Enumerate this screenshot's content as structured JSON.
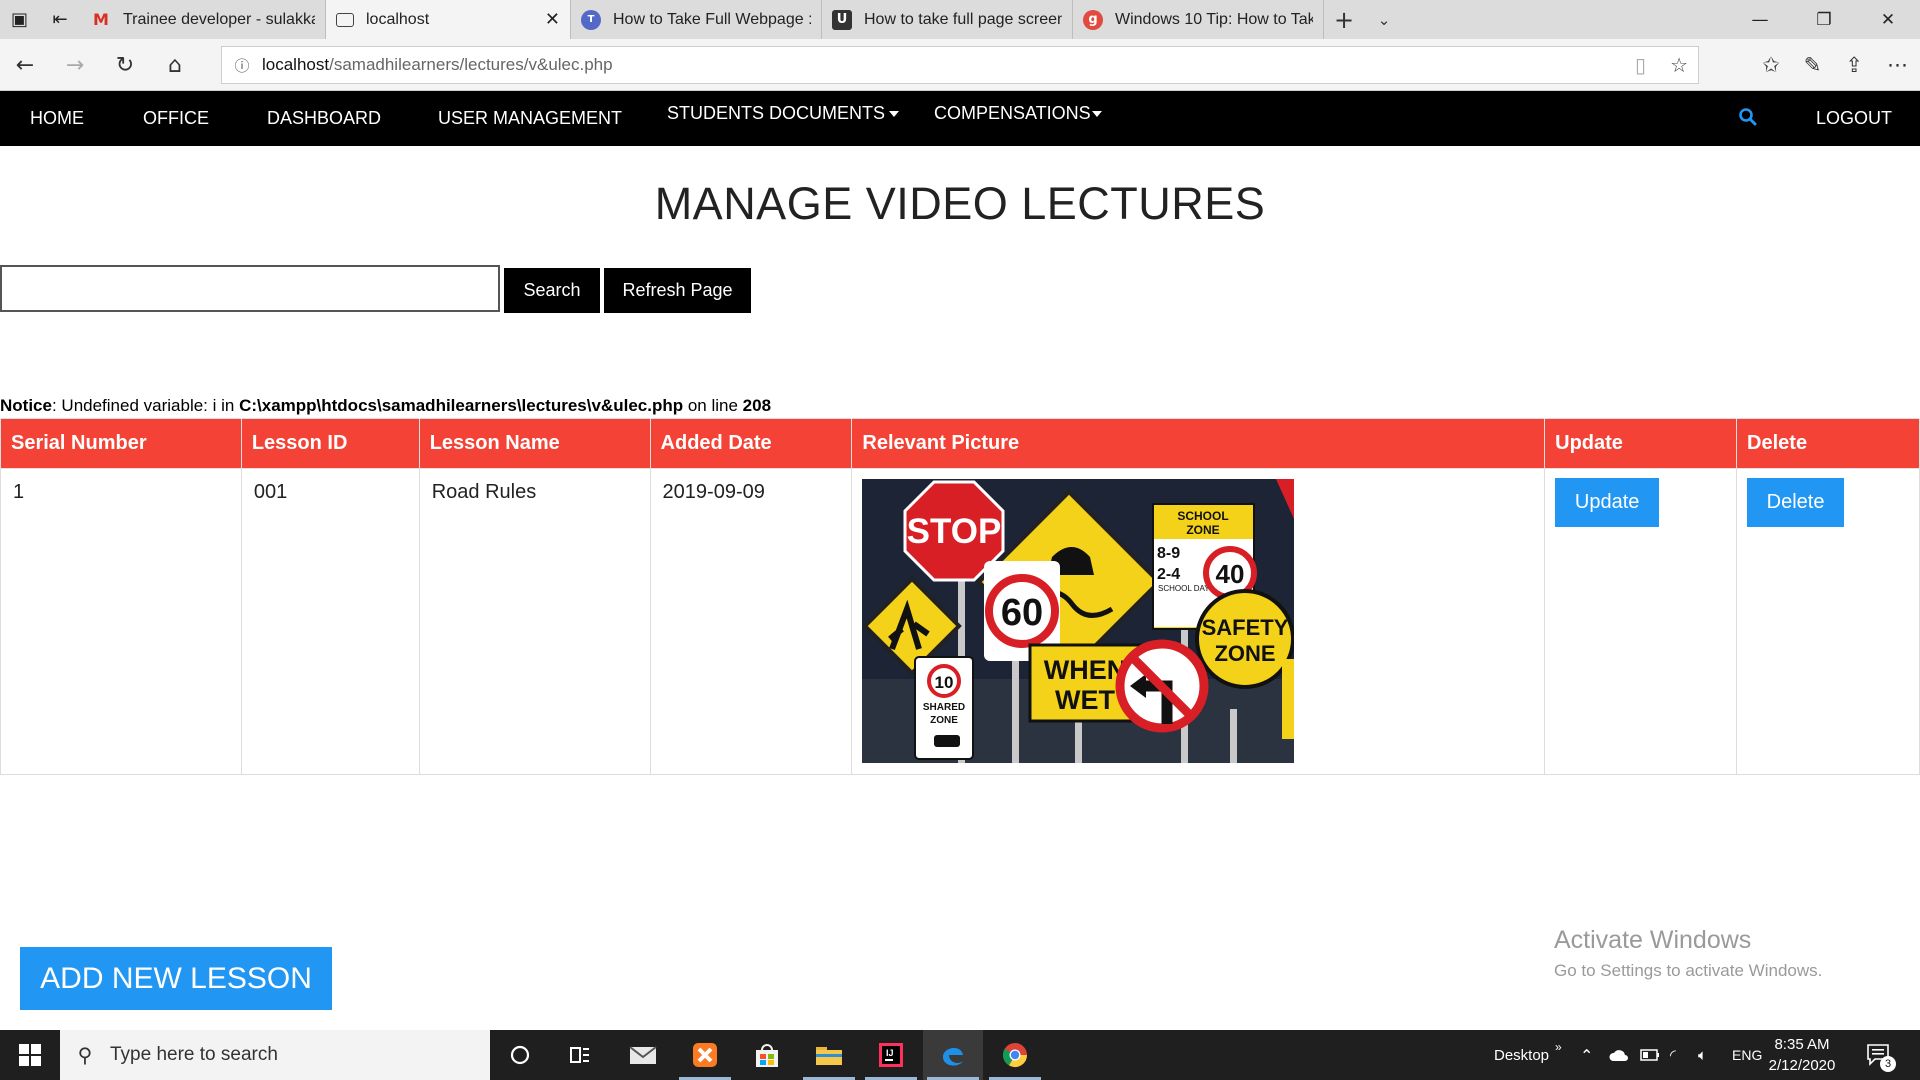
{
  "browser": {
    "tabs": [
      {
        "title": "Trainee developer - sulakkai",
        "favicon": "gmail-icon",
        "active": false
      },
      {
        "title": "localhost",
        "favicon": "page-icon",
        "active": true
      },
      {
        "title": "How to Take Full Webpage :",
        "favicon": "tt-icon",
        "active": false
      },
      {
        "title": "How to take full page screen",
        "favicon": "u-icon",
        "active": false
      },
      {
        "title": "Windows 10 Tip: How to Tak",
        "favicon": "g-icon",
        "active": false
      }
    ],
    "url_host": "localhost",
    "url_path": "/samadhilearners/lectures/v&ulec.php"
  },
  "nav": {
    "home": "HOME",
    "office": "OFFICE",
    "dashboard": "DASHBOARD",
    "user_management": "USER MANAGEMENT",
    "students_documents": "STUDENTS DOCUMENTS",
    "compensations": "COMPENSATIONS",
    "logout": "LOGOUT"
  },
  "page": {
    "title": "MANAGE VIDEO LECTURES",
    "search_value": "",
    "search_button": "Search",
    "refresh_button": "Refresh Page"
  },
  "notice": {
    "label": "Notice",
    "message": ": Undefined variable: i in ",
    "path": "C:\\xampp\\htdocs\\samadhilearners\\lectures\\v&ulec.php",
    "on_line": " on line ",
    "line": "208"
  },
  "table": {
    "headers": [
      "Serial Number",
      "Lesson ID",
      "Lesson Name",
      "Added Date",
      "Relevant Picture",
      "Update",
      "Delete"
    ],
    "rows": [
      {
        "serial": "1",
        "lesson_id": "001",
        "lesson_name": "Road Rules",
        "added_date": "2019-09-09",
        "update_label": "Update",
        "delete_label": "Delete"
      }
    ]
  },
  "sign_text": {
    "stop": "STOP",
    "sixty": "60",
    "school": "SCHOOL",
    "zone": "ZONE",
    "times1": "8-9",
    "times2": "2-4",
    "school_days": "SCHOOL DAYS",
    "forty": "40",
    "safety": "SAFETY",
    "safety_zone": "ZONE",
    "when": "WHEN",
    "wet": "WET",
    "ten": "10",
    "shared": "SHARED",
    "shared_zone": "ZONE"
  },
  "add_lesson": "ADD NEW LESSON",
  "watermark": {
    "line1": "Activate Windows",
    "line2": "Go to Settings to activate Windows."
  },
  "taskbar": {
    "search_placeholder": "Type here to search",
    "desktop": "Desktop",
    "lang": "ENG",
    "time": "8:35 AM",
    "date": "2/12/2020",
    "notifications": "3"
  },
  "colors": {
    "table_header": "#f44336",
    "button_blue": "#2196f3",
    "nav_bg": "#000000"
  }
}
